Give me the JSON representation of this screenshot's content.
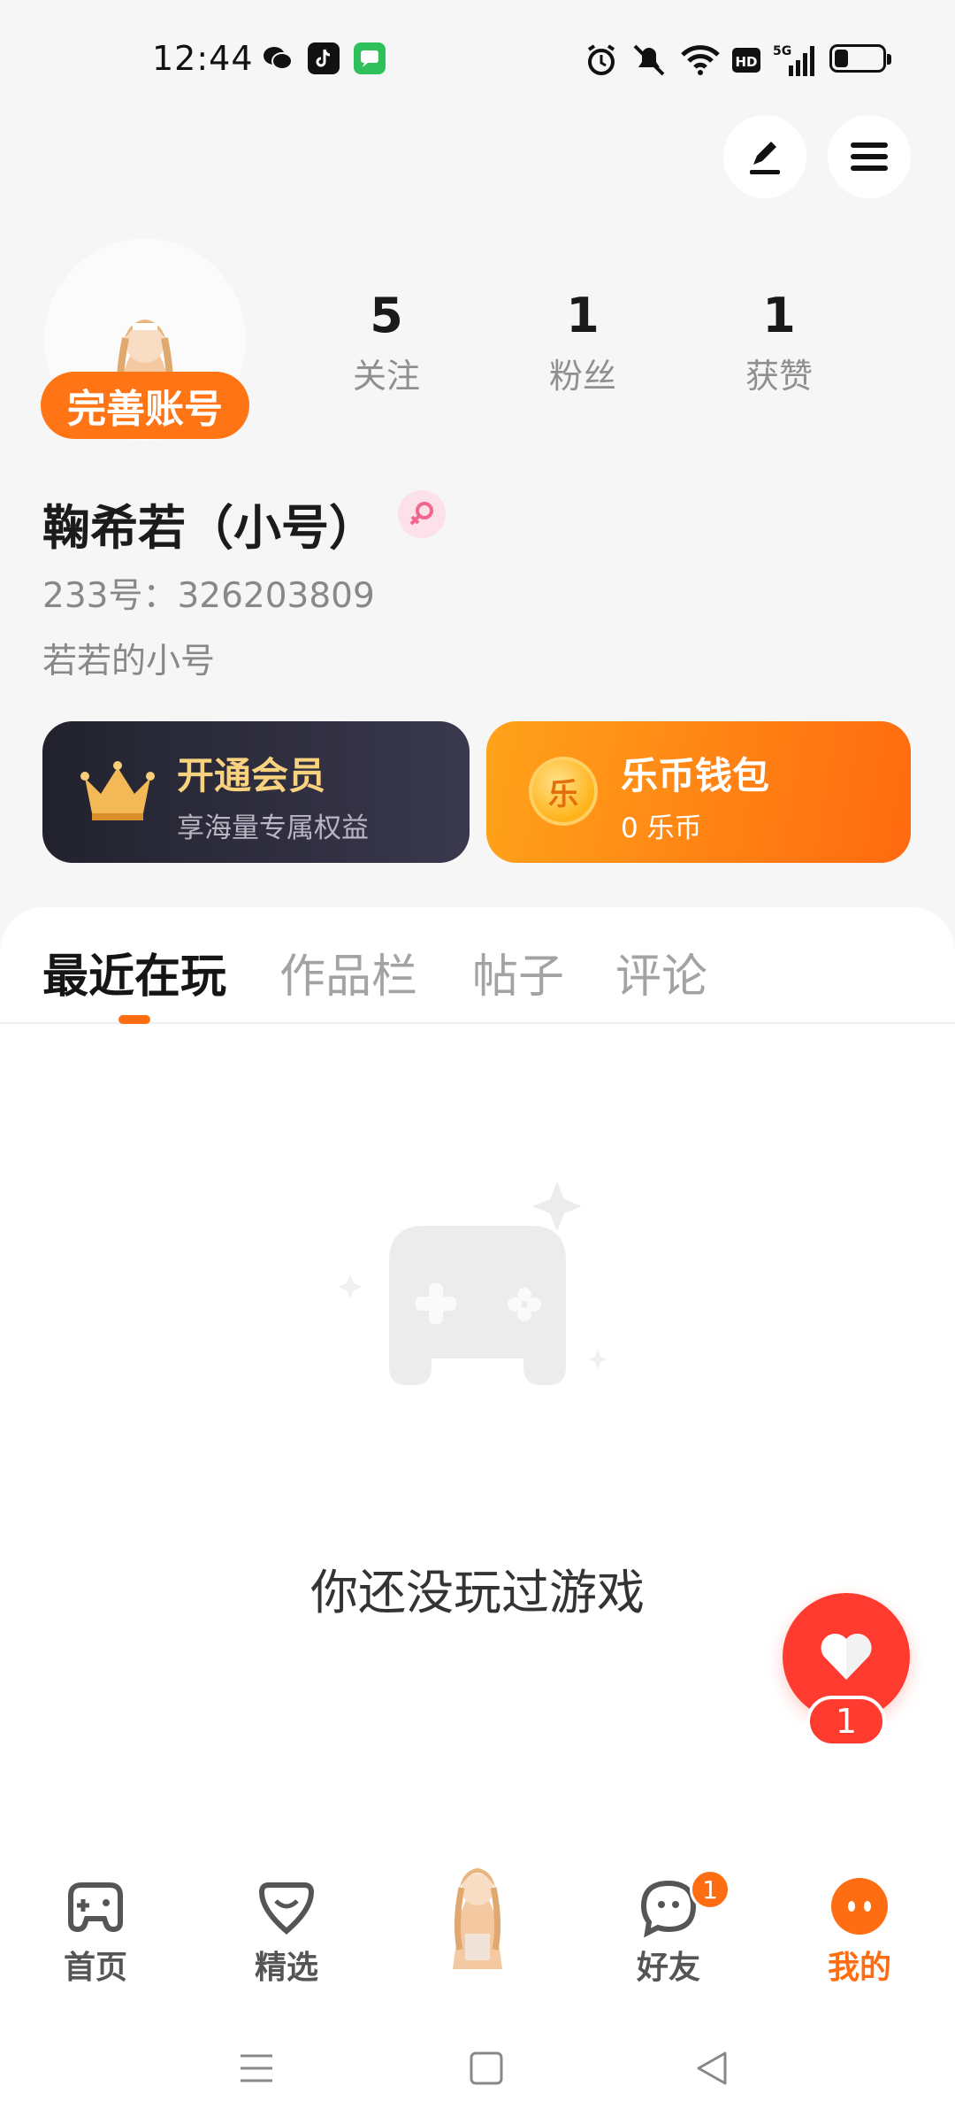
{
  "status_bar": {
    "time": "12:44",
    "battery_level": 0.25
  },
  "header": {
    "edit_icon": "pen-icon",
    "menu_icon": "hamburger-icon"
  },
  "profile": {
    "perfect_account_label": "完善账号",
    "stats": [
      {
        "value": "5",
        "label": "关注"
      },
      {
        "value": "1",
        "label": "粉丝"
      },
      {
        "value": "1",
        "label": "获赞"
      }
    ],
    "nickname": "鞠希若（小号）",
    "gender_icon": "female-icon",
    "id_text": "233号：326203809",
    "bio": "若若的小号"
  },
  "cards": {
    "vip": {
      "title": "开通会员",
      "subtitle": "享海量专属权益"
    },
    "wallet": {
      "title": "乐币钱包",
      "subtitle": "0 乐币",
      "coin_glyph": "乐"
    }
  },
  "tabs": [
    {
      "label": "最近在玩",
      "active": true
    },
    {
      "label": "作品栏",
      "active": false
    },
    {
      "label": "帖子",
      "active": false
    },
    {
      "label": "评论",
      "active": false
    }
  ],
  "empty_state": {
    "text": "你还没玩过游戏"
  },
  "fab": {
    "count": "1"
  },
  "bottom_nav": [
    {
      "label": "首页",
      "icon": "gamepad-icon",
      "active": false
    },
    {
      "label": "精选",
      "icon": "heart-shield-icon",
      "active": false
    },
    {
      "label": "",
      "icon": "character-avatar",
      "active": false
    },
    {
      "label": "好友",
      "icon": "chat-bubble-icon",
      "active": false,
      "badge": "1"
    },
    {
      "label": "我的",
      "icon": "face-icon",
      "active": true
    }
  ],
  "colors": {
    "accent": "#ff6d12",
    "vip_gold": "#f8d27f",
    "fab_red": "#ff3b30"
  }
}
